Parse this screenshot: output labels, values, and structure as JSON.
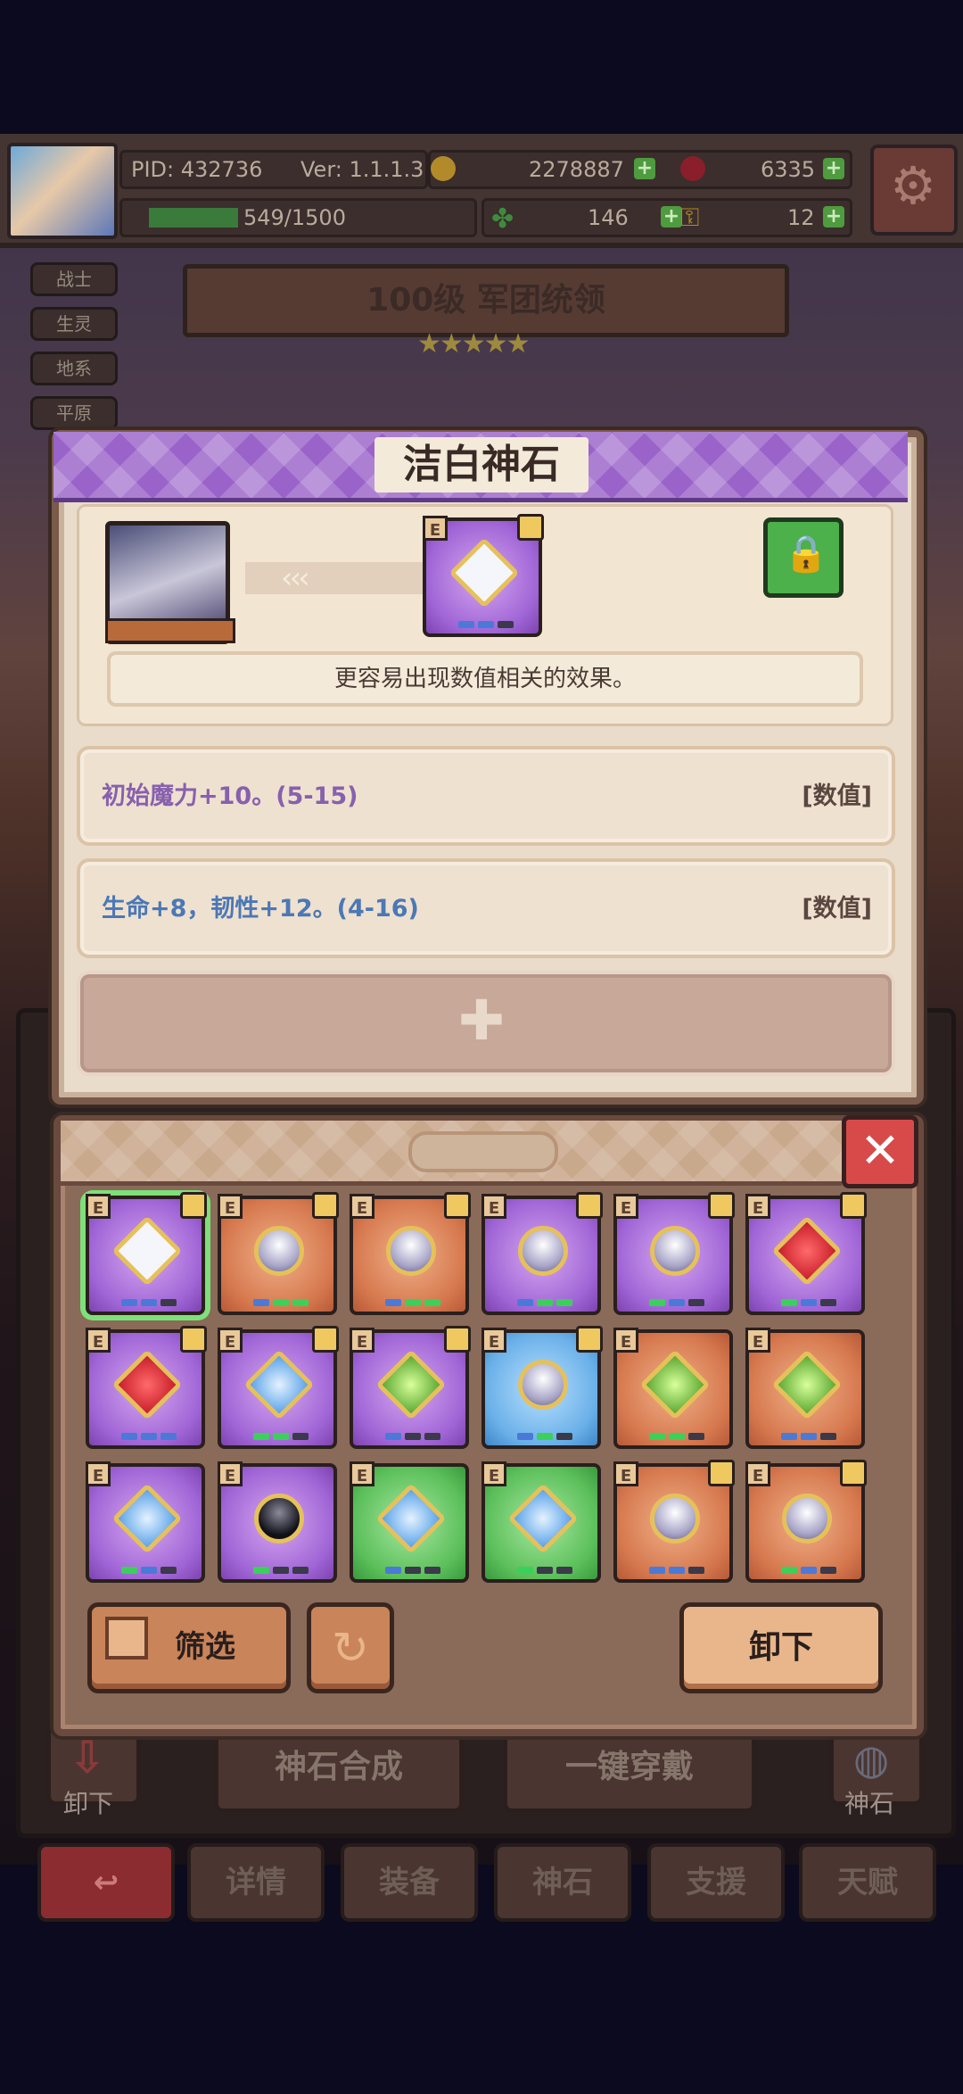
{
  "hud": {
    "pid": "PID: 432736",
    "version": "Ver: 1.1.1.3",
    "gold": "2278887",
    "gems": "6335",
    "xp": "549/1500",
    "clover": "146",
    "keys": "12"
  },
  "side_tags": [
    "战士",
    "生灵",
    "地系",
    "平原"
  ],
  "hero": {
    "level_title": "100级  军团统领",
    "stars": "★★★★★"
  },
  "detail": {
    "title": "洁白神石",
    "arrow": "‹‹‹",
    "description": "更容易出现数值相关的效果。",
    "attributes": [
      {
        "text": "初始魔力+10。(5-15)",
        "tag": "[数值]"
      },
      {
        "text": "生命+8，韧性+12。(4-16)",
        "tag": "[数值]"
      }
    ],
    "add_symbol": "✚"
  },
  "inventory": {
    "close_symbol": "✕",
    "filter_label": "筛选",
    "refresh_symbol": "↻",
    "unequip_label": "卸下",
    "badge": "E",
    "stones": [
      {
        "frame": "purple",
        "gem": "white",
        "selected": true,
        "lock": true,
        "dots": [
          "#4a7ad8",
          "#4a7ad8",
          "#3a3a4a"
        ]
      },
      {
        "frame": "orange",
        "gem": "pearl",
        "selected": false,
        "lock": true,
        "dots": [
          "#4a7ad8",
          "#3bd05a",
          "#3bd05a"
        ]
      },
      {
        "frame": "orange",
        "gem": "pearl",
        "selected": false,
        "lock": true,
        "dots": [
          "#4a7ad8",
          "#3bd05a",
          "#3bd05a"
        ]
      },
      {
        "frame": "purple",
        "gem": "pearl",
        "selected": false,
        "lock": true,
        "dots": [
          "#4a7ad8",
          "#3bd05a",
          "#3bd05a"
        ]
      },
      {
        "frame": "purple",
        "gem": "pearl",
        "selected": false,
        "lock": true,
        "dots": [
          "#3bd05a",
          "#4a7ad8",
          "#3a3a4a"
        ]
      },
      {
        "frame": "purple",
        "gem": "red",
        "selected": false,
        "lock": true,
        "dots": [
          "#3bd05a",
          "#4a7ad8",
          "#3a3a4a"
        ]
      },
      {
        "frame": "purple",
        "gem": "red",
        "selected": false,
        "lock": true,
        "dots": [
          "#4a7ad8",
          "#4a7ad8",
          "#4a7ad8"
        ]
      },
      {
        "frame": "purple",
        "gem": "sapph",
        "selected": false,
        "lock": true,
        "dots": [
          "#3bd05a",
          "#3bd05a",
          "#3a3a4a"
        ]
      },
      {
        "frame": "purple",
        "gem": "emer",
        "selected": false,
        "lock": true,
        "dots": [
          "#4a7ad8",
          "#3a3a4a",
          "#3a3a4a"
        ]
      },
      {
        "frame": "blue",
        "gem": "pearl",
        "selected": false,
        "lock": true,
        "dots": [
          "#4a7ad8",
          "#3bd05a",
          "#3a3a4a"
        ]
      },
      {
        "frame": "orange",
        "gem": "emer",
        "selected": false,
        "lock": false,
        "dots": [
          "#3bd05a",
          "#3bd05a",
          "#3a3a4a"
        ]
      },
      {
        "frame": "orange",
        "gem": "emer",
        "selected": false,
        "lock": false,
        "dots": [
          "#4a7ad8",
          "#4a7ad8",
          "#3a3a4a"
        ]
      },
      {
        "frame": "purple",
        "gem": "sapph",
        "selected": false,
        "lock": false,
        "dots": [
          "#3bd05a",
          "#4a7ad8",
          "#3a3a4a"
        ]
      },
      {
        "frame": "purple",
        "gem": "black",
        "selected": false,
        "lock": false,
        "dots": [
          "#3bd05a",
          "#3a3a4a",
          "#3a3a4a"
        ]
      },
      {
        "frame": "green",
        "gem": "sapph",
        "selected": false,
        "lock": false,
        "dots": [
          "#4a7ad8",
          "#3a3a4a",
          "#3a3a4a"
        ]
      },
      {
        "frame": "green",
        "gem": "sapph",
        "selected": false,
        "lock": false,
        "dots": [
          "#3bd05a",
          "#3a3a4a",
          "#3a3a4a"
        ]
      },
      {
        "frame": "orange",
        "gem": "pearl",
        "selected": false,
        "lock": true,
        "dots": [
          "#4a7ad8",
          "#4a7ad8",
          "#3a3a4a"
        ]
      },
      {
        "frame": "orange",
        "gem": "pearl",
        "selected": false,
        "lock": true,
        "dots": [
          "#3bd05a",
          "#4a7ad8",
          "#3a3a4a"
        ]
      }
    ]
  },
  "background_buttons": {
    "synth": "神石合成",
    "one_key_wear": "一键穿戴",
    "unequip": "卸下",
    "stone": "神石"
  },
  "nav": [
    "详情",
    "装备",
    "神石",
    "支援",
    "天赋"
  ],
  "nav_back_symbol": "↩"
}
